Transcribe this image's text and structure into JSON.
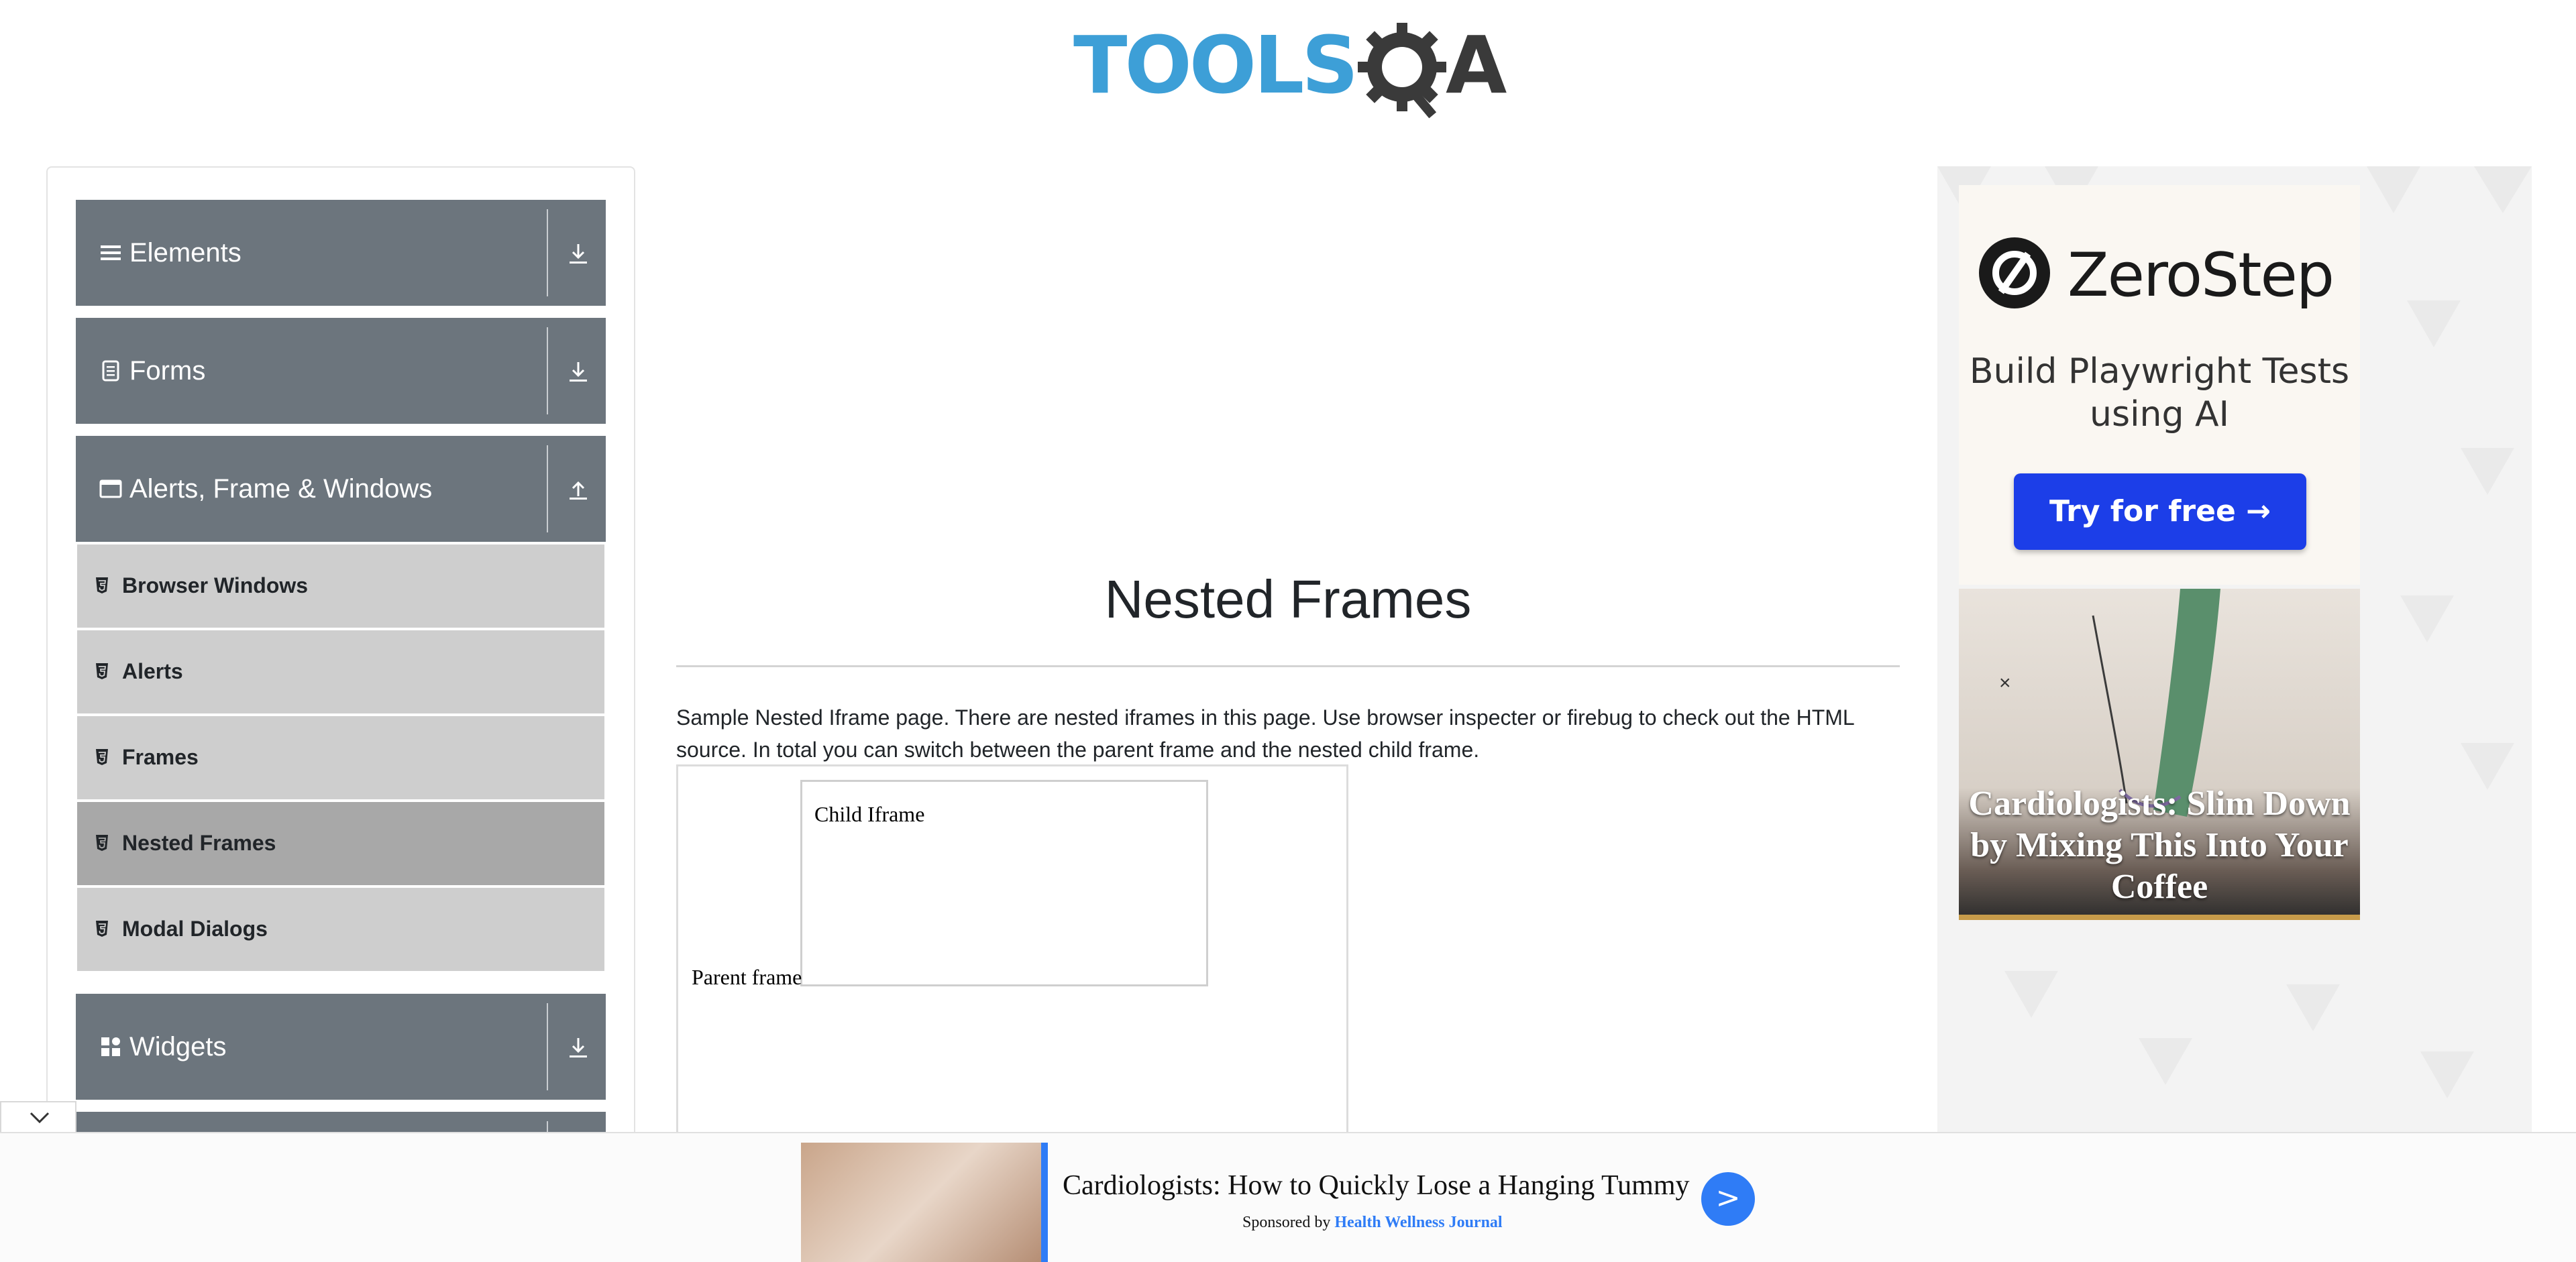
{
  "header": {
    "logo_tools": "TOOLS",
    "logo_a": "A"
  },
  "sidebar": {
    "groups": [
      {
        "label": "Elements",
        "icon": "menu-icon",
        "expanded": false
      },
      {
        "label": "Forms",
        "icon": "document-icon",
        "expanded": false
      },
      {
        "label": "Alerts, Frame & Windows",
        "icon": "window-icon",
        "expanded": true
      },
      {
        "label": "Widgets",
        "icon": "widgets-icon",
        "expanded": false
      }
    ],
    "items": [
      {
        "label": "Browser Windows",
        "active": false
      },
      {
        "label": "Alerts",
        "active": false
      },
      {
        "label": "Frames",
        "active": false
      },
      {
        "label": "Nested Frames",
        "active": true
      },
      {
        "label": "Modal Dialogs",
        "active": false
      }
    ]
  },
  "main": {
    "title": "Nested Frames",
    "description": "Sample Nested Iframe page. There are nested iframes in this page. Use browser inspecter or firebug to check out the HTML source. In total you can switch between the parent frame and the nested child frame.",
    "parent_frame_label": "Parent frame",
    "child_frame_label": "Child Iframe"
  },
  "ad_right": {
    "brand": "ZeroStep",
    "tagline": "Build Playwright Tests using AI",
    "cta": "Try for free →",
    "image_caption": "Cardiologists: Slim Down by Mixing This Into Your Coffee"
  },
  "bottom_ad": {
    "headline": "Cardiologists: How to Quickly Lose a Hanging Tummy",
    "sponsor_prefix": "Sponsored by",
    "sponsor_name": "Health Wellness Journal",
    "go_label": ">"
  },
  "colors": {
    "group_bg": "#6c757d",
    "item_bg": "#cecece",
    "item_active_bg": "#a8a8a8",
    "brand_blue": "#3d9fd7",
    "cta_blue": "#1c3ee8"
  }
}
